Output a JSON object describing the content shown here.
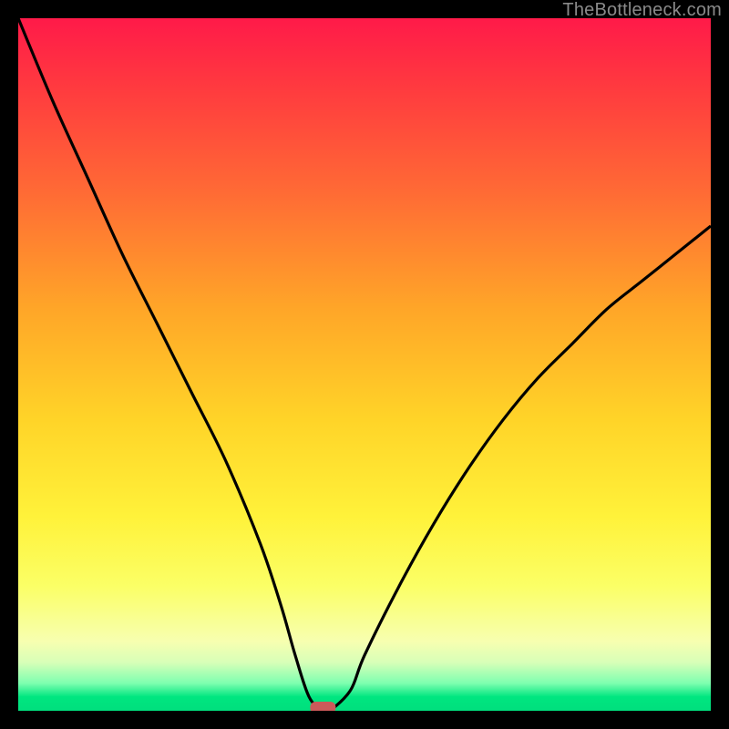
{
  "watermark": "TheBottleneck.com",
  "chart_data": {
    "type": "line",
    "title": "",
    "xlabel": "",
    "ylabel": "",
    "xlim": [
      0,
      100
    ],
    "ylim": [
      0,
      100
    ],
    "grid": false,
    "series": [
      {
        "name": "bottleneck-curve",
        "x": [
          0,
          5,
          10,
          15,
          20,
          25,
          30,
          35,
          38,
          40,
          42,
          44,
          45,
          48,
          50,
          55,
          60,
          65,
          70,
          75,
          80,
          85,
          90,
          95,
          100
        ],
        "values": [
          100,
          88,
          77,
          66,
          56,
          46,
          36,
          24,
          15,
          8,
          2,
          0,
          0,
          3,
          8,
          18,
          27,
          35,
          42,
          48,
          53,
          58,
          62,
          66,
          70
        ]
      }
    ],
    "marker": {
      "x": 44,
      "y": 0,
      "shape": "rounded-rect",
      "color": "#cc5a5a"
    },
    "background_gradient": {
      "direction": "top-to-bottom",
      "stops": [
        {
          "pos": 0,
          "color": "#ff1a49"
        },
        {
          "pos": 25,
          "color": "#ff6a35"
        },
        {
          "pos": 58,
          "color": "#ffd428"
        },
        {
          "pos": 90,
          "color": "#f7ffb0"
        },
        {
          "pos": 100,
          "color": "#00df7d"
        }
      ]
    }
  }
}
